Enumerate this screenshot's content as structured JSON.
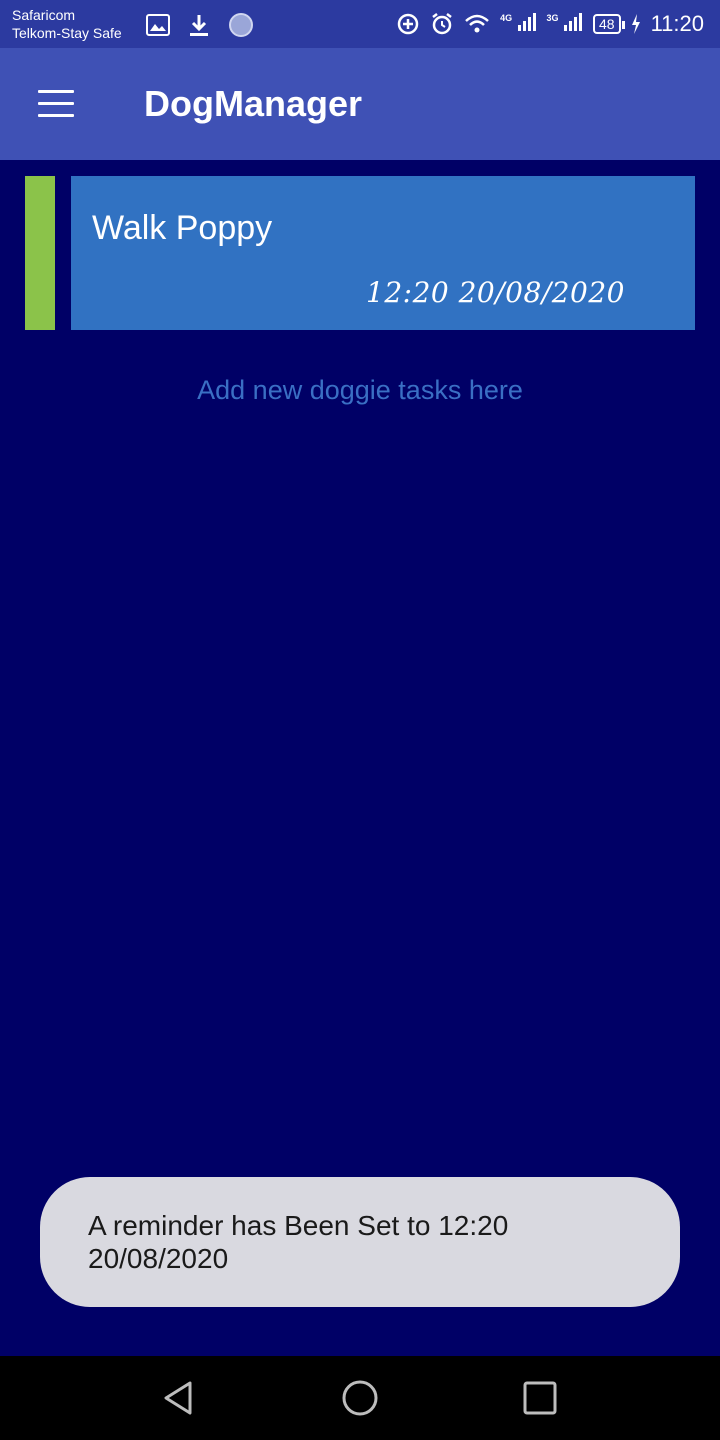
{
  "status_bar": {
    "carrier_1": "Safaricom",
    "carrier_2": "Telkom-Stay Safe",
    "network_1": "4G",
    "network_2": "3G",
    "battery": "48",
    "time": "11:20"
  },
  "app_bar": {
    "title": "DogManager"
  },
  "tasks": [
    {
      "title": "Walk Poppy",
      "datetime": "12:20  20/08/2020",
      "strip_color": "#8bc34a"
    }
  ],
  "add_hint": "Add new doggie tasks here",
  "toast": {
    "message": "A reminder has Been Set to 12:20 20/08/2020"
  },
  "colors": {
    "background": "#000066",
    "app_bar": "#3f51b5",
    "card": "#3172c2"
  }
}
